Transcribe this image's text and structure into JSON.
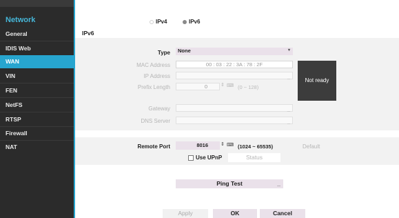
{
  "sidebar": {
    "title": "Network",
    "items": [
      {
        "label": "General"
      },
      {
        "label": "IDIS Web"
      },
      {
        "label": "WAN"
      },
      {
        "label": "VIN"
      },
      {
        "label": "FEN"
      },
      {
        "label": "NetFS"
      },
      {
        "label": "RTSP"
      },
      {
        "label": "Firewall"
      },
      {
        "label": "NAT"
      }
    ],
    "active_index": 2
  },
  "ip_version": {
    "options": [
      "IPv4",
      "IPv6"
    ],
    "selected": "IPv6"
  },
  "section_title": "IPv6",
  "form": {
    "type_label": "Type",
    "type_value": "None",
    "mac_label": "MAC Address",
    "mac_value": "00 : 03 : 22 : 3A : 78 : 2F",
    "ip_label": "IP Address",
    "ip_value": "",
    "prefix_label": "Prefix Length",
    "prefix_value": "0",
    "prefix_range": "(0 ~ 128)",
    "gateway_label": "Gateway",
    "dns_label": "DNS Server",
    "status_box": "Not ready"
  },
  "port": {
    "remote_port_label": "Remote Port",
    "remote_port_value": "8016",
    "remote_port_range": "(1024 ~ 65535)",
    "default_label": "Default",
    "upnp_label": "Use UPnP",
    "upnp_checked": false,
    "status_label": "Status"
  },
  "ping_test_label": "Ping Test",
  "footer": {
    "apply_label": "Apply",
    "ok_label": "OK",
    "cancel_label": "Cancel"
  },
  "colors": {
    "accent": "#27a5cf",
    "sidebar_bg": "#2b2b2b",
    "status_box_bg": "#3c3c3c",
    "button_bg": "#eae1ea"
  }
}
